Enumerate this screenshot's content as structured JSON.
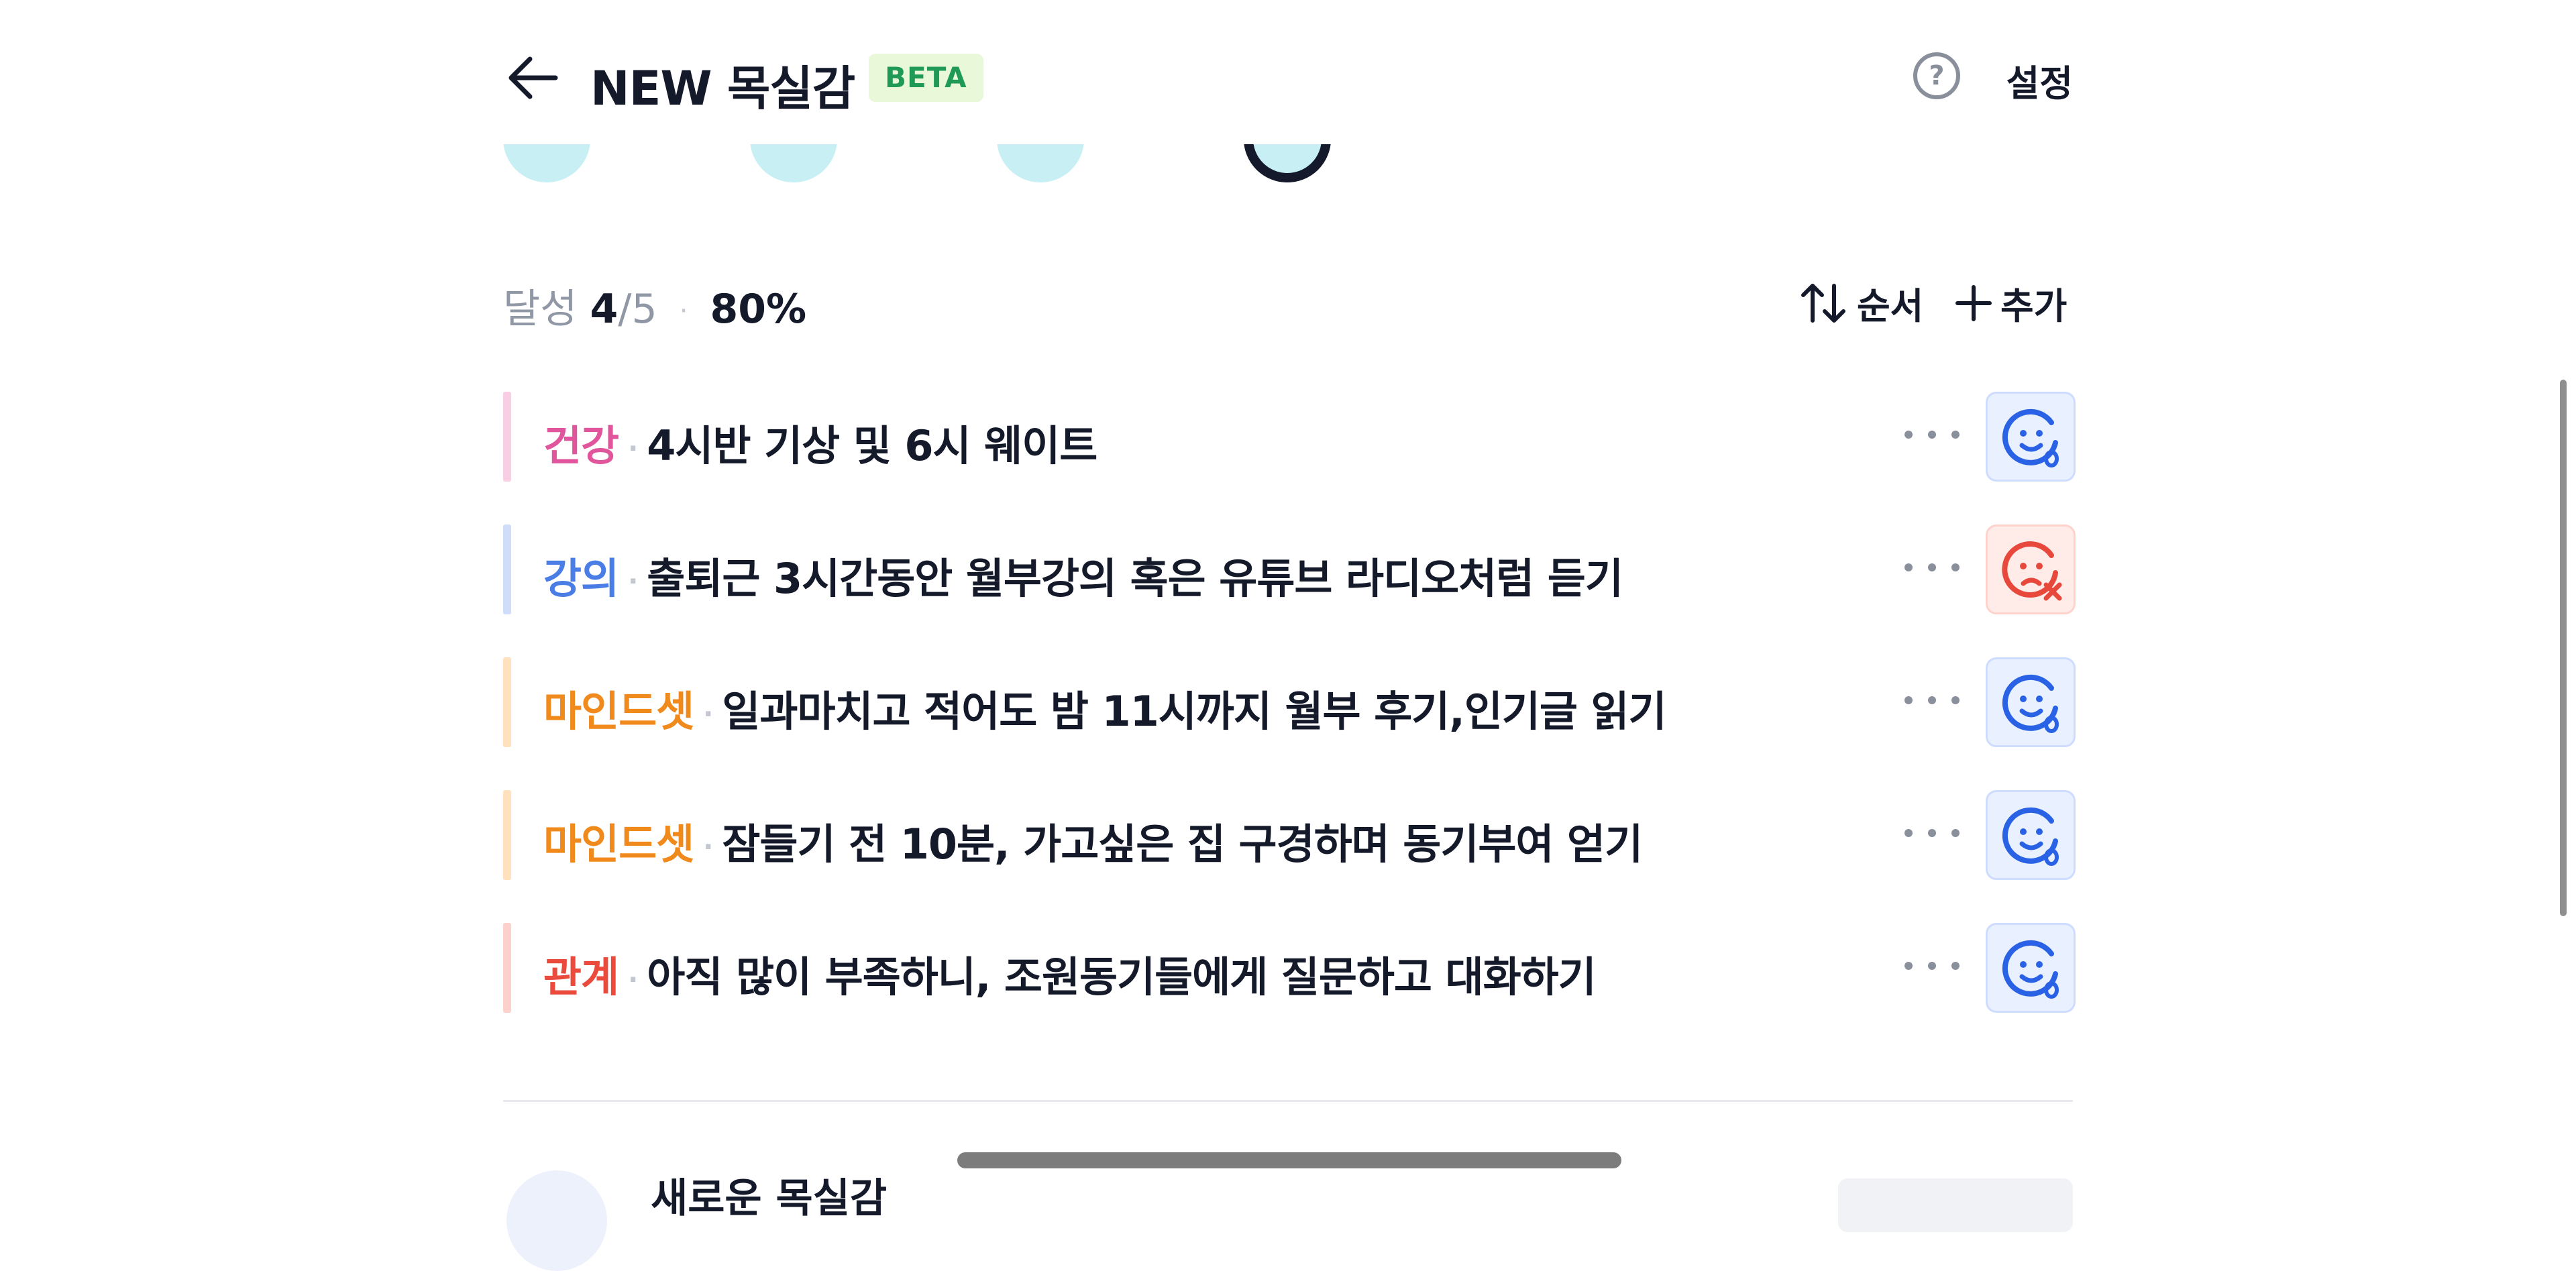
{
  "header": {
    "title": "NEW 목실감",
    "badge": "BETA",
    "settings_label": "설정",
    "help_glyph": "?"
  },
  "summary": {
    "label": "달성",
    "done": "4",
    "total": "/5",
    "separator": "·",
    "percent": "80%"
  },
  "actions": {
    "sort_label": "순서",
    "add_label": "추가"
  },
  "colors": {
    "health": "#e0559b",
    "lecture": "#4a7ee6",
    "mindset": "#f08a1c",
    "relation": "#ea4b3c",
    "ok_icon": "#2a62e6",
    "fail_icon": "#e8483c"
  },
  "items": [
    {
      "category": "건강",
      "text": "4시반 기상 및 6시 웨이트",
      "status": "success"
    },
    {
      "category": "강의",
      "text": "출퇴근 3시간동안 월부강의 혹은 유튜브 라디오처럼 듣기",
      "status": "fail"
    },
    {
      "category": "마인드셋",
      "text": "일과마치고 적어도 밤 11시까지 월부 후기,인기글 읽기",
      "status": "success"
    },
    {
      "category": "마인드셋",
      "text": "잠들기 전 10분, 가고싶은 집 구경하며 동기부여 얻기",
      "status": "success"
    },
    {
      "category": "관계",
      "text": "아직 많이 부족하니, 조원동기들에게 질문하고 대화하기",
      "status": "success"
    }
  ],
  "next_section": {
    "title": "새로운 목실감"
  }
}
